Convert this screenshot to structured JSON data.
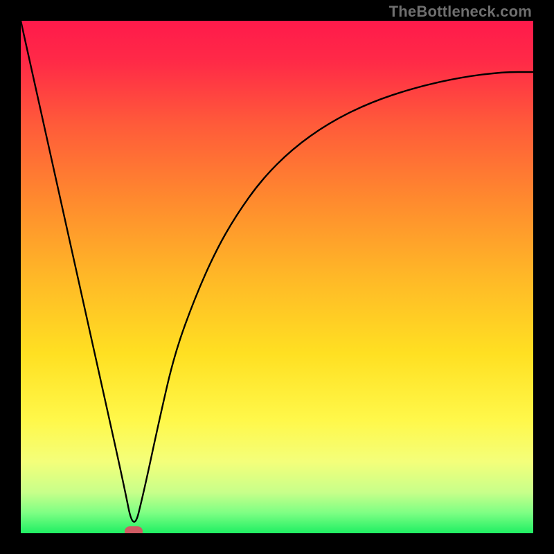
{
  "watermark": "TheBottleneck.com",
  "chart_data": {
    "type": "line",
    "title": "",
    "xlabel": "",
    "ylabel": "",
    "xlim": [
      0,
      100
    ],
    "ylim": [
      0,
      100
    ],
    "grid": false,
    "legend": false,
    "background_gradient_stops": [
      {
        "pos": 0.0,
        "color": "#ff1a4b"
      },
      {
        "pos": 0.08,
        "color": "#ff2a47"
      },
      {
        "pos": 0.2,
        "color": "#ff5a3a"
      },
      {
        "pos": 0.35,
        "color": "#ff8a2e"
      },
      {
        "pos": 0.5,
        "color": "#ffb827"
      },
      {
        "pos": 0.65,
        "color": "#ffe022"
      },
      {
        "pos": 0.78,
        "color": "#fff84a"
      },
      {
        "pos": 0.86,
        "color": "#f4ff7a"
      },
      {
        "pos": 0.92,
        "color": "#c8ff8a"
      },
      {
        "pos": 0.96,
        "color": "#7eff84"
      },
      {
        "pos": 1.0,
        "color": "#1fef63"
      }
    ],
    "min_marker": {
      "x": 22,
      "y": 0,
      "color": "#cf5b63"
    },
    "series": [
      {
        "name": "bottleneck-curve",
        "x": [
          0,
          4,
          8,
          12,
          16,
          20,
          22,
          24,
          27,
          30,
          34,
          38,
          42,
          47,
          53,
          60,
          68,
          77,
          86,
          94,
          100
        ],
        "y": [
          100,
          82,
          64,
          46,
          28,
          10,
          0,
          8,
          22,
          35,
          46,
          55,
          62,
          69,
          75,
          80,
          84,
          87,
          89,
          90,
          90
        ]
      }
    ]
  }
}
